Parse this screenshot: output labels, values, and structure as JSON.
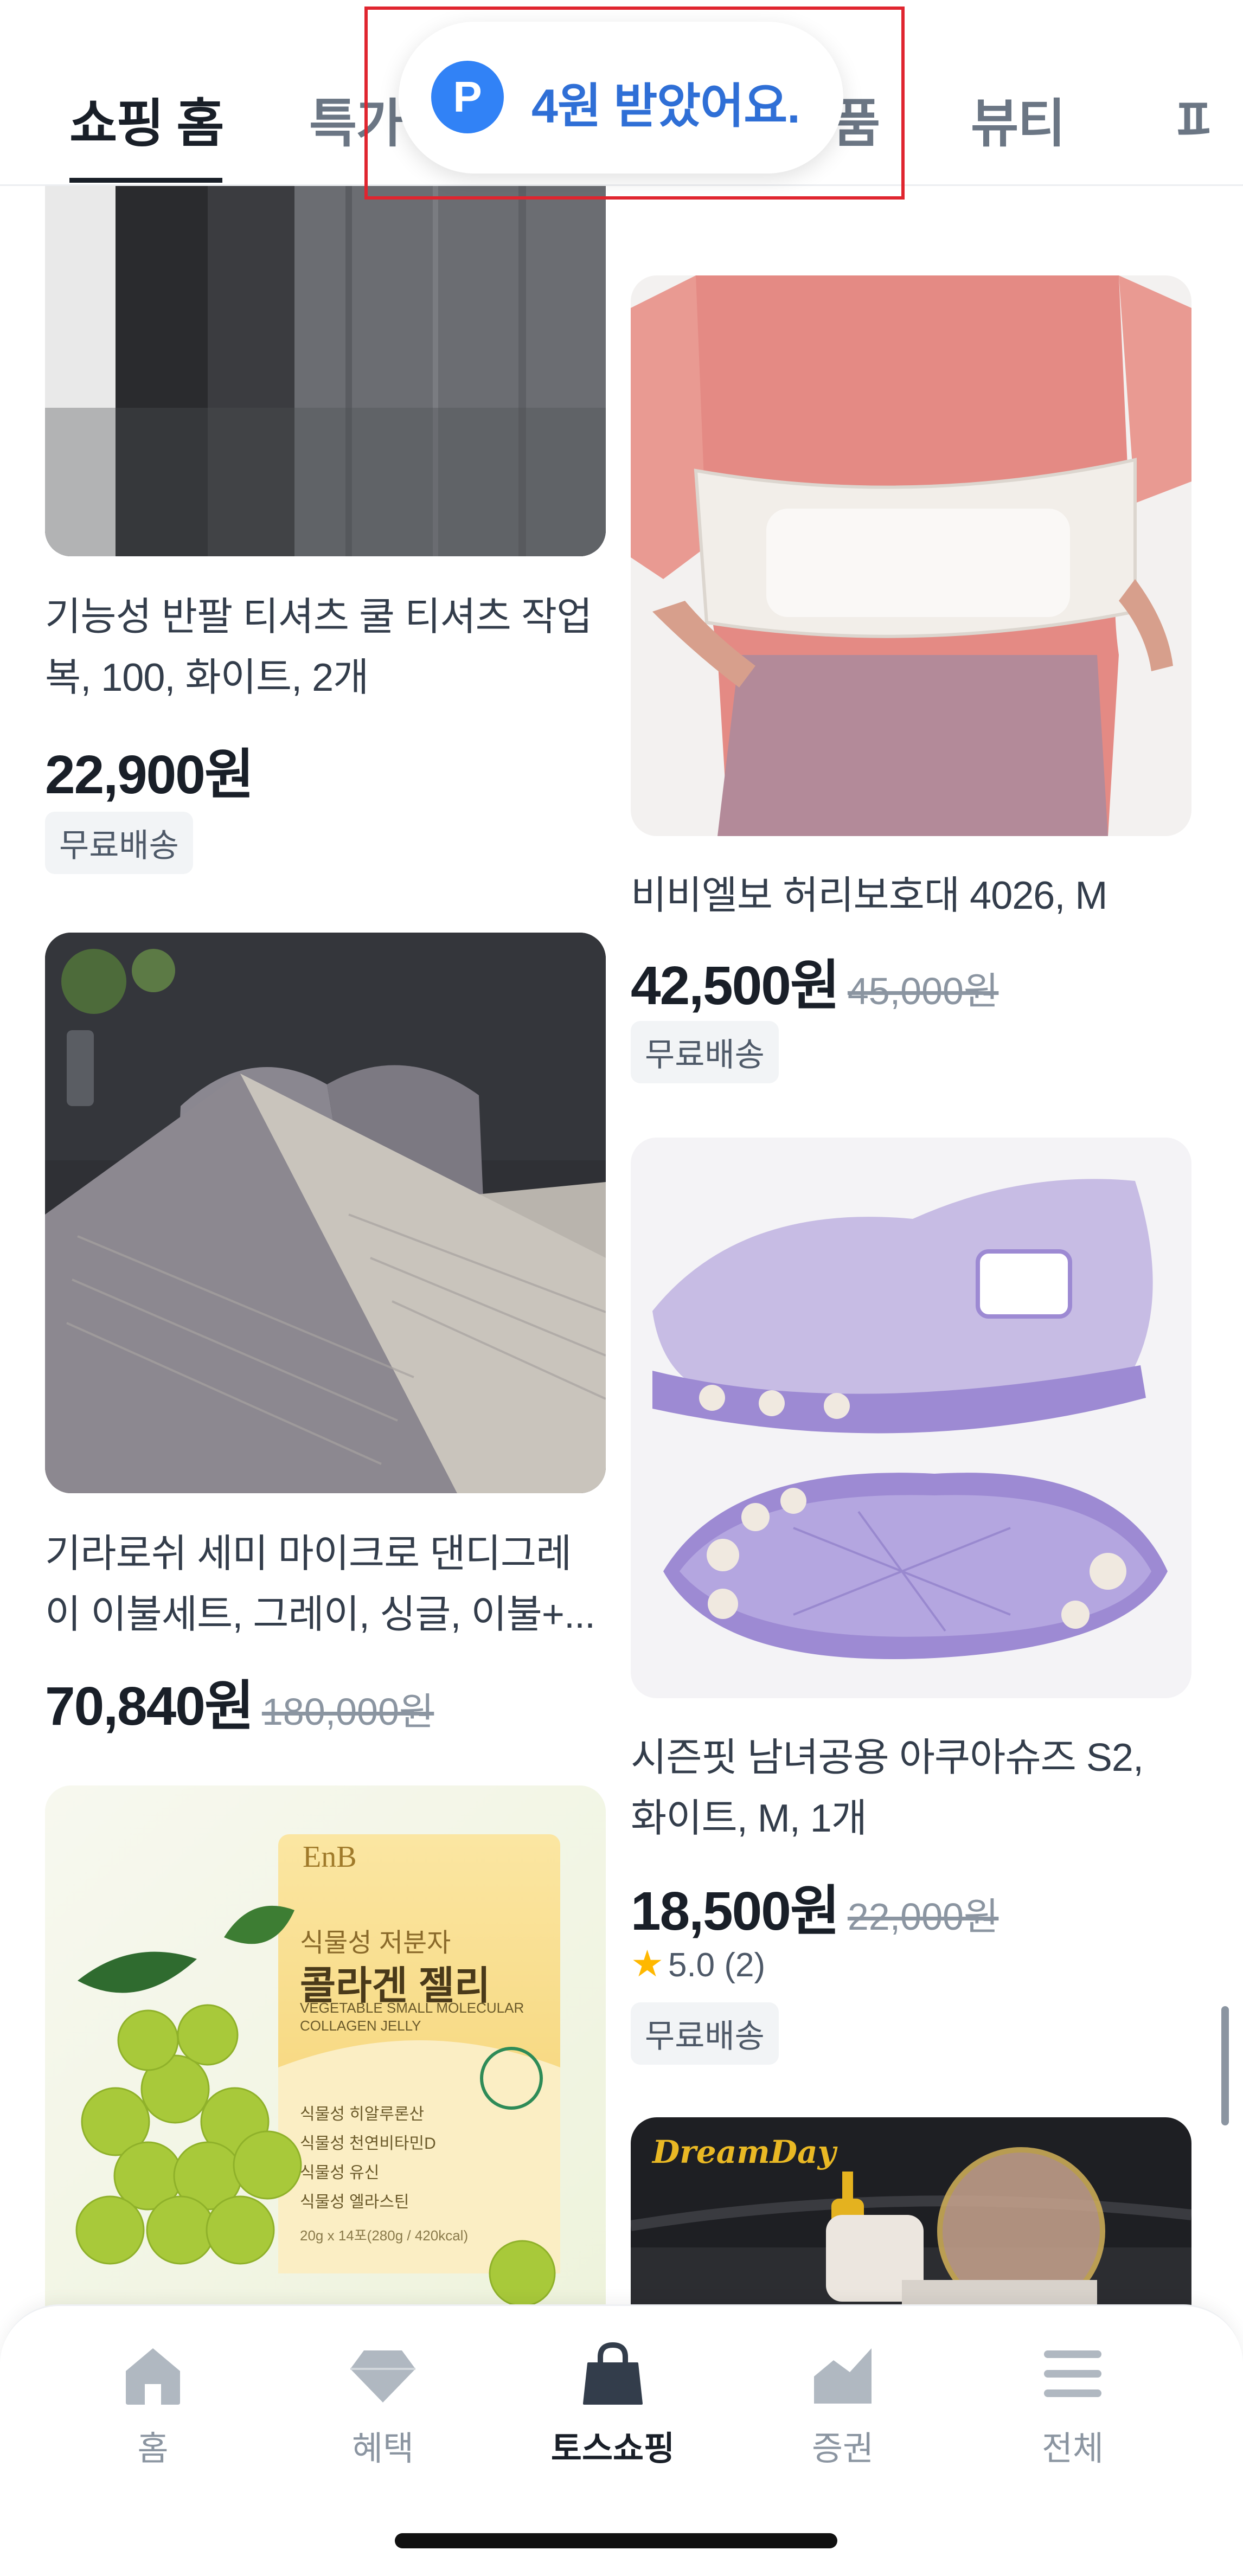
{
  "tabs": [
    {
      "label": "쇼핑 홈",
      "active": true
    },
    {
      "label": "특가"
    },
    {
      "label": "품"
    },
    {
      "label": "뷰티"
    },
    {
      "label": "파"
    }
  ],
  "toast": {
    "badge": "P",
    "message": "4원 받았어요."
  },
  "products": [
    {
      "title_line1": "기능성 반팔 티셔츠 쿨 티셔츠 작업",
      "title_line2": "복, 100, 화이트, 2개",
      "price": "22,900원",
      "original_price": "",
      "badge": "무료배송"
    },
    {
      "title_line1": "비비엘보 허리보호대 4026, M",
      "title_line2": "",
      "price": "42,500원",
      "original_price": "45,000원",
      "badge": "무료배송"
    },
    {
      "title_line1": "기라로쉬 세미 마이크로 댄디그레",
      "title_line2": "이 이불세트, 그레이, 싱글, 이불+...",
      "price": "70,840원",
      "original_price": "180,000원",
      "badge": ""
    },
    {
      "title_line1": "시즌핏 남녀공용 아쿠아슈즈 S2,",
      "title_line2": "화이트, M, 1개",
      "price": "18,500원",
      "original_price": "22,000원",
      "rating": "5.0 (2)",
      "badge": "무료배송"
    },
    {
      "brand": "EnB",
      "subtitle": "식물성 저분자",
      "name": "콜라겐 젤리",
      "eng1": "VEGETABLE SMALL MOLECULAR",
      "eng2": "COLLAGEN JELLY",
      "bullets": [
        "식물성 히알루론산",
        "식물성 천연비타민D",
        "식물성 유신",
        "식물성 엘라스틴"
      ],
      "weight": "20g x 14포(280g / 420kcal)"
    },
    {
      "brand": "DreamDay"
    }
  ],
  "nav": [
    {
      "label": "홈",
      "icon": "home-icon"
    },
    {
      "label": "혜택",
      "icon": "diamond-icon"
    },
    {
      "label": "토스쇼핑",
      "icon": "shopping-bag-icon",
      "active": true
    },
    {
      "label": "증권",
      "icon": "chart-icon"
    },
    {
      "label": "전체",
      "icon": "menu-icon"
    }
  ],
  "colors": {
    "accent": "#3182f6",
    "highlight_border": "#e0252f"
  }
}
